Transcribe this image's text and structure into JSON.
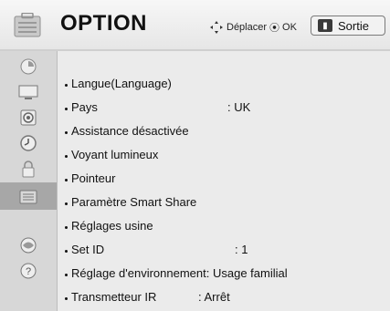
{
  "header": {
    "title": "OPTION",
    "nav_hint": "Déplacer",
    "ok_hint": "OK",
    "exit_label": "Sortie"
  },
  "sidebar": {
    "items": [
      {
        "icon": "picture-icon"
      },
      {
        "icon": "tv-screen-icon"
      },
      {
        "icon": "speaker-icon"
      },
      {
        "icon": "clock-icon"
      },
      {
        "icon": "lock-icon"
      },
      {
        "icon": "option-icon",
        "active": true
      },
      {
        "icon": "network-icon"
      },
      {
        "icon": "help-icon"
      }
    ]
  },
  "menu": {
    "items": [
      {
        "label": "Langue(Language)",
        "value": ""
      },
      {
        "label": "Pays",
        "value": ": UK"
      },
      {
        "label": "Assistance désactivée",
        "value": ""
      },
      {
        "label": "Voyant lumineux",
        "value": ""
      },
      {
        "label": "Pointeur",
        "value": ""
      },
      {
        "label": "Paramètre Smart Share",
        "value": ""
      },
      {
        "label": "Réglages usine",
        "value": ""
      },
      {
        "label": "Set ID",
        "value": ": 1"
      },
      {
        "label": "Réglage d'environnement: Usage familial",
        "value": ""
      },
      {
        "label": "Transmetteur IR",
        "value": ": Arrêt"
      }
    ]
  }
}
